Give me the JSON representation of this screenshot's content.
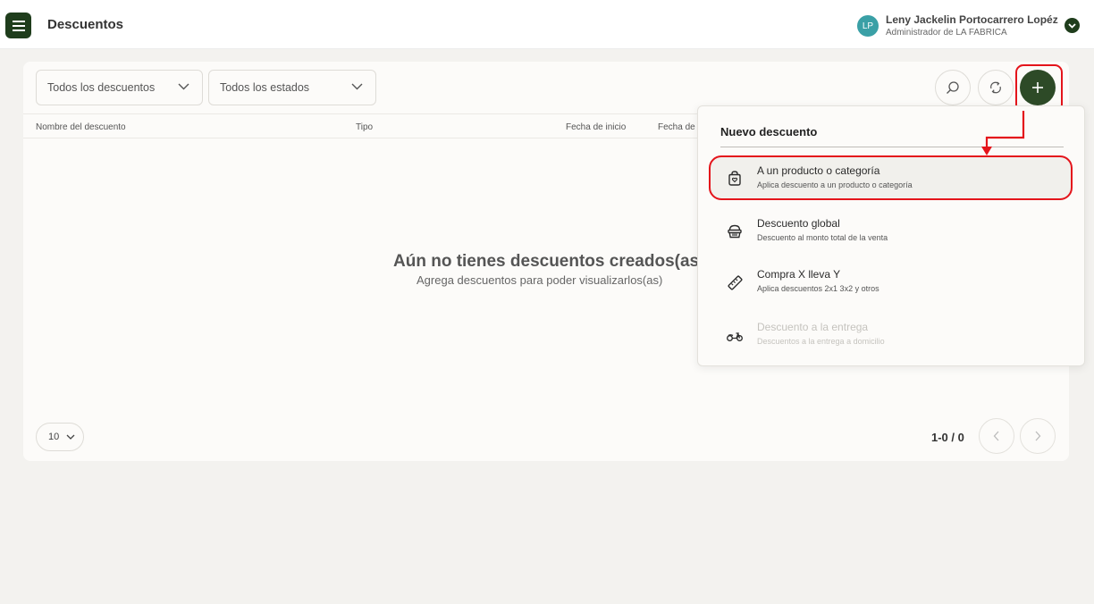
{
  "header": {
    "title": "Descuentos",
    "user": {
      "initials": "LP",
      "name": "Leny Jackelin Portocarrero Lopéz",
      "role": "Administrador de LA FABRICA"
    }
  },
  "filters": {
    "discount_type": "Todos los descuentos",
    "status": "Todos los estados"
  },
  "table": {
    "columns": [
      "Nombre del descuento",
      "Tipo",
      "Fecha de inicio",
      "Fecha de"
    ]
  },
  "empty_state": {
    "title": "Aún no tienes descuentos creados(as)",
    "subtitle": "Agrega descuentos para poder visualizarlos(as)"
  },
  "pagination": {
    "page_size": "10",
    "range": "1-0 / 0"
  },
  "new_discount_menu": {
    "title": "Nuevo descuento",
    "items": [
      {
        "label": "A un producto o categoría",
        "description": "Aplica descuento a un producto o categoría",
        "icon": "shopping-bag-icon",
        "enabled": true
      },
      {
        "label": "Descuento global",
        "description": "Descuento al monto total de la venta",
        "icon": "basket-icon",
        "enabled": true
      },
      {
        "label": "Compra X lleva Y",
        "description": "Aplica descuentos 2x1 3x2 y otros",
        "icon": "tag-icon",
        "enabled": true
      },
      {
        "label": "Descuento a la entrega",
        "description": "Descuentos a la entrega a domicilio",
        "icon": "scooter-icon",
        "enabled": false
      }
    ]
  },
  "colors": {
    "brand_dark": "#1f3d1c",
    "add_button": "#2d4a27",
    "highlight": "#e4141b",
    "avatar": "#3aa0a6"
  }
}
